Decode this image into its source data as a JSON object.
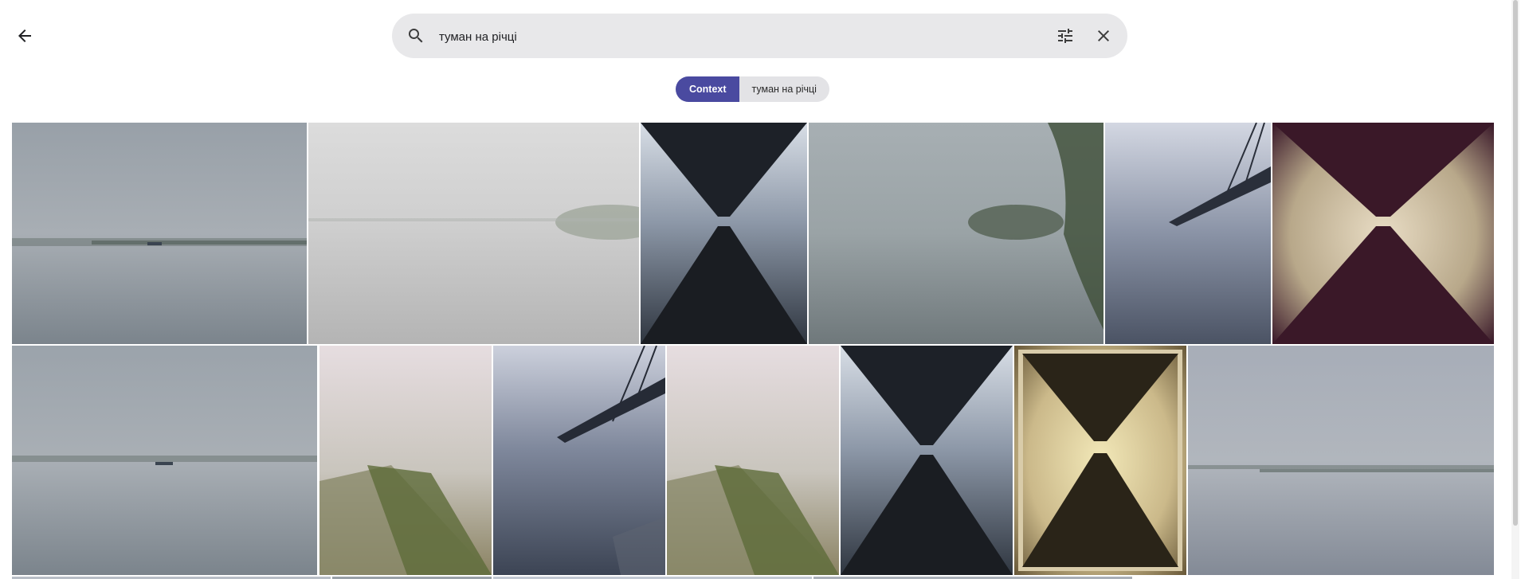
{
  "search": {
    "query": "туман на річці"
  },
  "chips": [
    {
      "label": "Context"
    },
    {
      "label": "туман на річці"
    }
  ],
  "icons": {
    "back": "arrow-back-icon",
    "search": "search-icon",
    "filter": "tune-icon",
    "clear": "close-icon"
  },
  "colors": {
    "chip_active": "#4a4aa0",
    "chip_inactive": "#e3e3e6",
    "searchbar": "#e8e8ea"
  }
}
